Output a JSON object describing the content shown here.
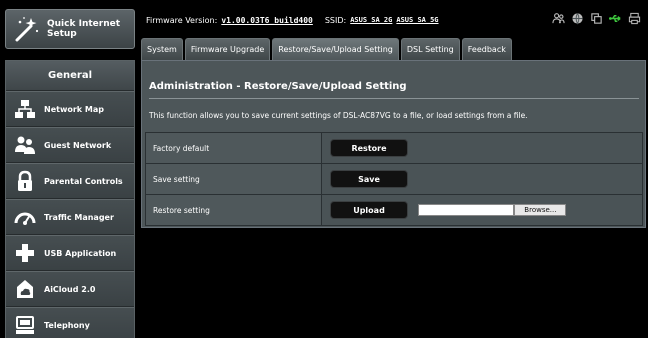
{
  "quick_setup": {
    "line1": "Quick Internet",
    "line2": "Setup"
  },
  "sidebar": {
    "title": "General",
    "items": [
      {
        "label": "Network Map",
        "icon": "network-map-icon"
      },
      {
        "label": "Guest Network",
        "icon": "guest-network-icon"
      },
      {
        "label": "Parental Controls",
        "icon": "parental-controls-icon"
      },
      {
        "label": "Traffic Manager",
        "icon": "traffic-manager-icon"
      },
      {
        "label": "USB Application",
        "icon": "usb-application-icon"
      },
      {
        "label": "AiCloud 2.0",
        "icon": "aicloud-icon"
      },
      {
        "label": "Telephony",
        "icon": "telephony-icon"
      }
    ]
  },
  "topbar": {
    "firmware_label": "Firmware Version:",
    "firmware_value": "v1.00.03T6_build400",
    "ssid_label": "SSID:",
    "ssid_2g": "ASUS_SA_2G",
    "ssid_5g": "ASUS_SA_5G",
    "status_icons": [
      "users-icon",
      "globe-icon",
      "copy-icon",
      "usb-icon",
      "printer-icon"
    ],
    "usb_color": "#3ec63e"
  },
  "tabs": [
    {
      "label": "System",
      "active": false
    },
    {
      "label": "Firmware Upgrade",
      "active": false
    },
    {
      "label": "Restore/Save/Upload Setting",
      "active": true
    },
    {
      "label": "DSL Setting",
      "active": false
    },
    {
      "label": "Feedback",
      "active": false
    }
  ],
  "panel": {
    "title": "Administration - Restore/Save/Upload Setting",
    "description": "This function allows you to save current settings of DSL-AC87VG to a file, or load settings from a file.",
    "rows": [
      {
        "label": "Factory default",
        "button": "Restore"
      },
      {
        "label": "Save setting",
        "button": "Save"
      },
      {
        "label": "Restore setting",
        "button": "Upload",
        "browse": "Browse..."
      }
    ]
  }
}
